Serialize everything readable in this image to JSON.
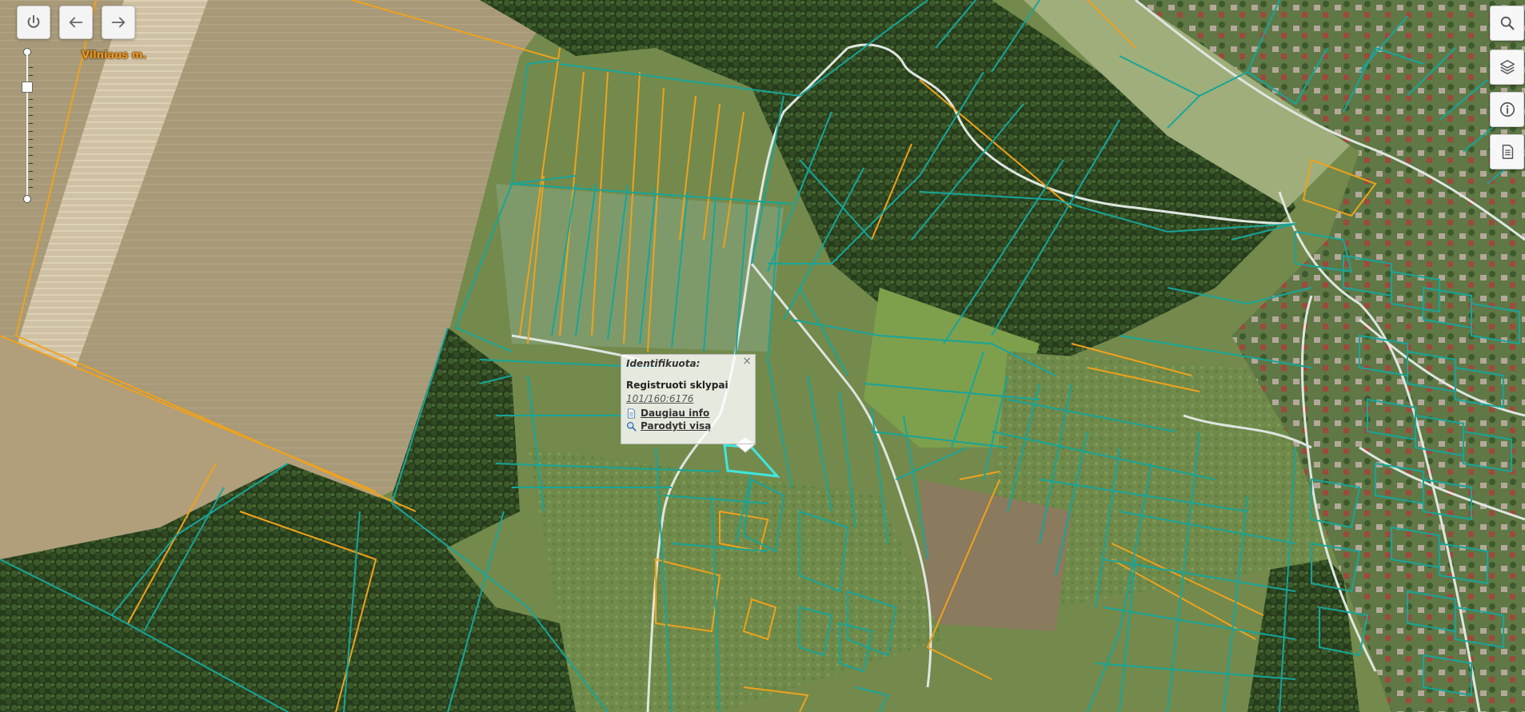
{
  "map": {
    "city_label": "Vilniaus m.",
    "colors": {
      "parcel_registered": "#17a59a",
      "parcel_other": "#f0a21b",
      "parcel_selected": "#3fe6e0",
      "road": "#d9e2dc"
    }
  },
  "toolbar": {
    "power_icon": "power-icon",
    "back_icon": "arrow-left-icon",
    "forward_icon": "arrow-right-icon"
  },
  "right_tools": [
    {
      "name": "search-button",
      "icon": "search-icon"
    },
    {
      "name": "layers-button",
      "icon": "layers-icon"
    },
    {
      "name": "info-button",
      "icon": "info-icon"
    },
    {
      "name": "legend-button",
      "icon": "document-icon"
    }
  ],
  "popup": {
    "title": "Identifikuota:",
    "close_label": "×",
    "layer_title": "Registruoti sklypai",
    "parcel_id": "101/160:6176",
    "more_info": "Daugiau info",
    "show_all": "Parodyti visą"
  },
  "zoom": {
    "level_fraction": 0.24
  }
}
